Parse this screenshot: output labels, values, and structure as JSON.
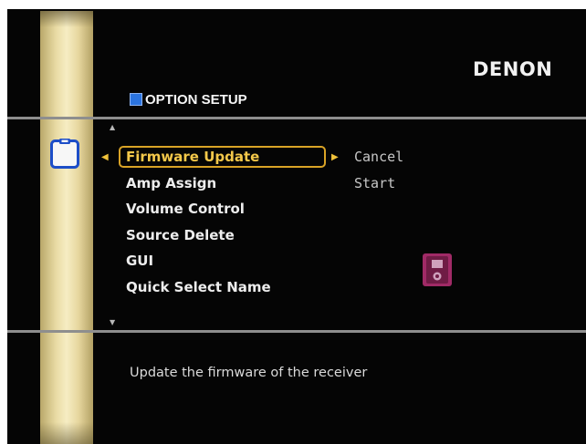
{
  "header": {
    "brand": "DENON",
    "title": "OPTION SETUP"
  },
  "menu": {
    "items": [
      {
        "label": "Firmware Update",
        "selected": true
      },
      {
        "label": "Amp Assign",
        "selected": false
      },
      {
        "label": "Volume Control",
        "selected": false
      },
      {
        "label": "Source Delete",
        "selected": false
      },
      {
        "label": "GUI",
        "selected": false
      },
      {
        "label": "Quick Select Name",
        "selected": false
      }
    ]
  },
  "options": {
    "values": [
      "Cancel",
      "Start"
    ]
  },
  "footer": {
    "description": "Update the firmware of the receiver"
  },
  "icons": {
    "category": "clipboard-icon",
    "device": "portable-player-icon",
    "scroll_up": "scroll-up-arrow-icon",
    "scroll_down": "scroll-down-arrow-icon"
  },
  "colors": {
    "background": "#050505",
    "accent": "#f4c84a",
    "title_marker": "#2b74e0",
    "device_icon": "#a02a66",
    "side_bar": "#e9dba4"
  }
}
